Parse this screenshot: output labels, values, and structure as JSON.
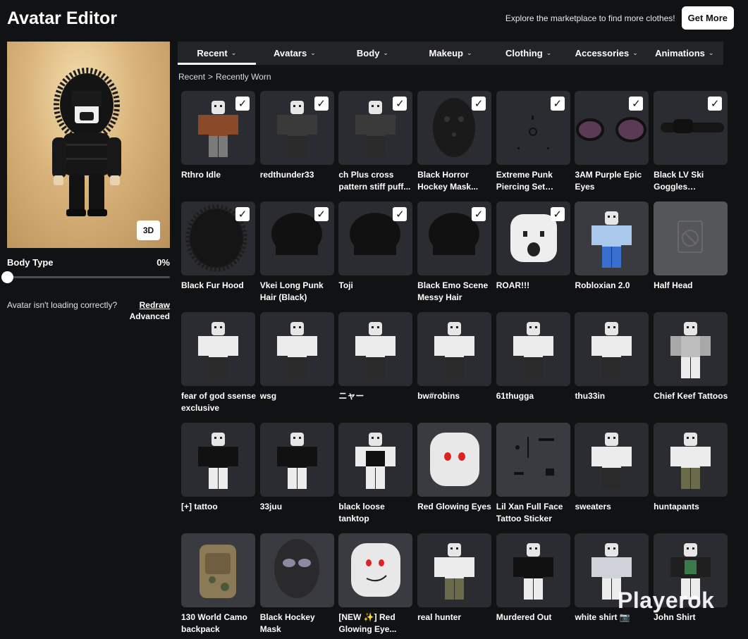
{
  "header": {
    "title": "Avatar Editor",
    "promo_text": "Explore the marketplace to find more clothes!",
    "get_more_label": "Get More"
  },
  "preview": {
    "btn_3d_label": "3D",
    "body_type_label": "Body Type",
    "body_type_value": "0%",
    "body_type_fraction": 0,
    "loading_text": "Avatar isn't loading correctly?",
    "redraw_label": "Redraw",
    "advanced_label": "Advanced"
  },
  "tabs": [
    {
      "label": "Recent",
      "active": true
    },
    {
      "label": "Avatars",
      "active": false
    },
    {
      "label": "Body",
      "active": false
    },
    {
      "label": "Makeup",
      "active": false
    },
    {
      "label": "Clothing",
      "active": false
    },
    {
      "label": "Accessories",
      "active": false
    },
    {
      "label": "Animations",
      "active": false
    }
  ],
  "breadcrumb": {
    "root": "Recent",
    "separator": ">",
    "current": "Recently Worn"
  },
  "items": [
    {
      "name": "Rthro Idle",
      "checked": true,
      "icon": "rthro-figure"
    },
    {
      "name": "redthunder33",
      "checked": true,
      "icon": "figure-dark"
    },
    {
      "name": "ch Plus cross pattern stiff puff...",
      "checked": true,
      "icon": "figure-dark"
    },
    {
      "name": "Black Horror Hockey Mask...",
      "checked": true,
      "icon": "hockey-mask"
    },
    {
      "name": "Extreme Punk Piercing Set (Black)",
      "checked": true,
      "icon": "piercings"
    },
    {
      "name": "3AM Purple Epic Eyes",
      "checked": true,
      "icon": "purple-eyes"
    },
    {
      "name": "Black LV Ski Goggles Headband",
      "checked": true,
      "icon": "goggles"
    },
    {
      "name": "Black Fur Hood",
      "checked": true,
      "icon": "fur-hood"
    },
    {
      "name": "Vkei Long Punk Hair (Black)",
      "checked": true,
      "icon": "hair"
    },
    {
      "name": "Toji",
      "checked": true,
      "icon": "hair"
    },
    {
      "name": "Black Emo Scene Messy Hair",
      "checked": true,
      "icon": "hair"
    },
    {
      "name": "ROAR!!!",
      "checked": true,
      "icon": "roar-face"
    },
    {
      "name": "Robloxian 2.0",
      "checked": false,
      "icon": "robloxian"
    },
    {
      "name": "Half Head",
      "checked": false,
      "icon": "unavailable"
    },
    {
      "name": "fear of god ssense exclusive",
      "checked": false,
      "icon": "figure-white-pants"
    },
    {
      "name": "wsg",
      "checked": false,
      "icon": "figure-white-pants"
    },
    {
      "name": "ニャー",
      "checked": false,
      "icon": "figure-white-pants"
    },
    {
      "name": "bw#robins",
      "checked": false,
      "icon": "figure-white-pants"
    },
    {
      "name": "61thugga",
      "checked": false,
      "icon": "figure-white-pants"
    },
    {
      "name": "thu33in",
      "checked": false,
      "icon": "figure-white-pants"
    },
    {
      "name": "Chief Keef Tattoos",
      "checked": false,
      "icon": "figure-tattoo"
    },
    {
      "name": "[+] tattoo",
      "checked": false,
      "icon": "figure-black-shirt"
    },
    {
      "name": "33juu",
      "checked": false,
      "icon": "figure-black-shirt"
    },
    {
      "name": "black loose tanktop",
      "checked": false,
      "icon": "figure-tanktop"
    },
    {
      "name": "Red Glowing Eyes",
      "checked": false,
      "icon": "red-eyes-head"
    },
    {
      "name": "Lil Xan Full Face Tattoo Sticker",
      "checked": false,
      "icon": "face-tattoo"
    },
    {
      "name": "sweaters",
      "checked": false,
      "icon": "figure-white-pants"
    },
    {
      "name": "huntapants",
      "checked": false,
      "icon": "figure-camo-pants"
    },
    {
      "name": "130 World Camo backpack",
      "checked": false,
      "icon": "camo-backpack"
    },
    {
      "name": "Black Hockey Mask",
      "checked": false,
      "icon": "hockey-mask-black"
    },
    {
      "name": "[NEW ✨] Red Glowing Eye...",
      "checked": false,
      "icon": "red-eyes-smile"
    },
    {
      "name": "real hunter",
      "checked": false,
      "icon": "figure-camo-pants"
    },
    {
      "name": "Murdered Out",
      "checked": false,
      "icon": "figure-black-shirt"
    },
    {
      "name": "white shirt 📷",
      "checked": false,
      "icon": "figure-white-shirt"
    },
    {
      "name": "John Shirt",
      "checked": false,
      "icon": "figure-color-shirt"
    }
  ],
  "watermark": "Playerok",
  "colors": {
    "background": "#111214",
    "card": "#2b2c31",
    "tab_bar": "#232428",
    "accent": "#ffffff"
  }
}
